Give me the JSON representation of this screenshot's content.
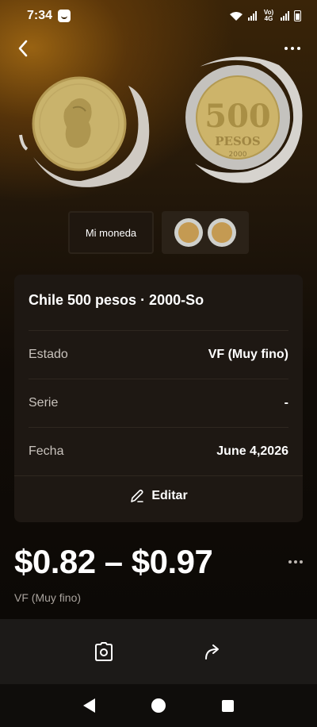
{
  "status": {
    "time": "7:34",
    "network_label": "Vo) 4G"
  },
  "icons": {
    "back": "chevron-left-icon",
    "more": "more-horizontal-icon",
    "edit": "pencil-icon",
    "photo": "camera-frame-icon",
    "share": "share-arrow-icon"
  },
  "coin": {
    "reverse_numeral": "500",
    "reverse_text": "PESOS",
    "reverse_year": "2000"
  },
  "thumbnails": {
    "my_coin_label": "Mi moneda"
  },
  "details": {
    "title": "Chile 500 pesos · 2000-So",
    "rows": [
      {
        "label": "Estado",
        "value": "VF (Muy fino)"
      },
      {
        "label": "Serie",
        "value": "-"
      },
      {
        "label": "Fecha",
        "value": "June 4,2026"
      }
    ],
    "edit_label": "Editar"
  },
  "price": {
    "range": "$0.82 – $0.97",
    "grade": "VF (Muy fino)"
  },
  "colors": {
    "accent_gold": "#c8a85a",
    "background": "#0c0906",
    "card": "#1e1813"
  }
}
